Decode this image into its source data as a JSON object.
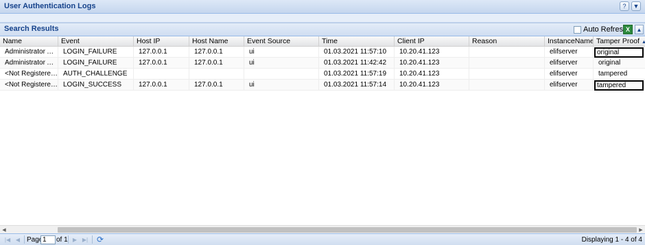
{
  "panel": {
    "title": "User Authentication Logs"
  },
  "results": {
    "title": "Search Results",
    "auto_refresh_label": "Auto Refresh",
    "auto_refresh_checked": false
  },
  "columns": [
    "Name",
    "Event",
    "Host IP",
    "Host Name",
    "Event Source",
    "Time",
    "Client IP",
    "Reason",
    "InstanceName",
    "Tamper Proof"
  ],
  "sorted_column": "Tamper Proof",
  "sort_direction": "ascending",
  "rows": [
    [
      "Administrator Ad...",
      "LOGIN_FAILURE",
      "127.0.0.1",
      "127.0.0.1",
      "ui",
      "01.03.2021 11:57:10",
      "10.20.41.123",
      "",
      "elifserver",
      "original"
    ],
    [
      "Administrator Ad...",
      "LOGIN_FAILURE",
      "127.0.0.1",
      "127.0.0.1",
      "ui",
      "01.03.2021 11:42:42",
      "10.20.41.123",
      "",
      "elifserver",
      "original"
    ],
    [
      "<Not Registered> ...",
      "AUTH_CHALLENGE",
      "",
      "",
      "",
      "01.03.2021 11:57:19",
      "10.20.41.123",
      "",
      "elifserver",
      "tampered"
    ],
    [
      "<Not Registered> ...",
      "LOGIN_SUCCESS",
      "127.0.0.1",
      "127.0.0.1",
      "ui",
      "01.03.2021 11:57:14",
      "10.20.41.123",
      "",
      "elifserver",
      "tampered"
    ]
  ],
  "pager": {
    "page_label": "Page",
    "page_value": "1",
    "of_label": "of 1",
    "display_label": "Displaying 1 - 4 of 4"
  },
  "icons": {
    "help": "help-icon",
    "dropdown": "chevron-down-icon",
    "excel": "excel-export-icon",
    "collapse": "collapse-up-icon",
    "refresh": "refresh-icon"
  }
}
